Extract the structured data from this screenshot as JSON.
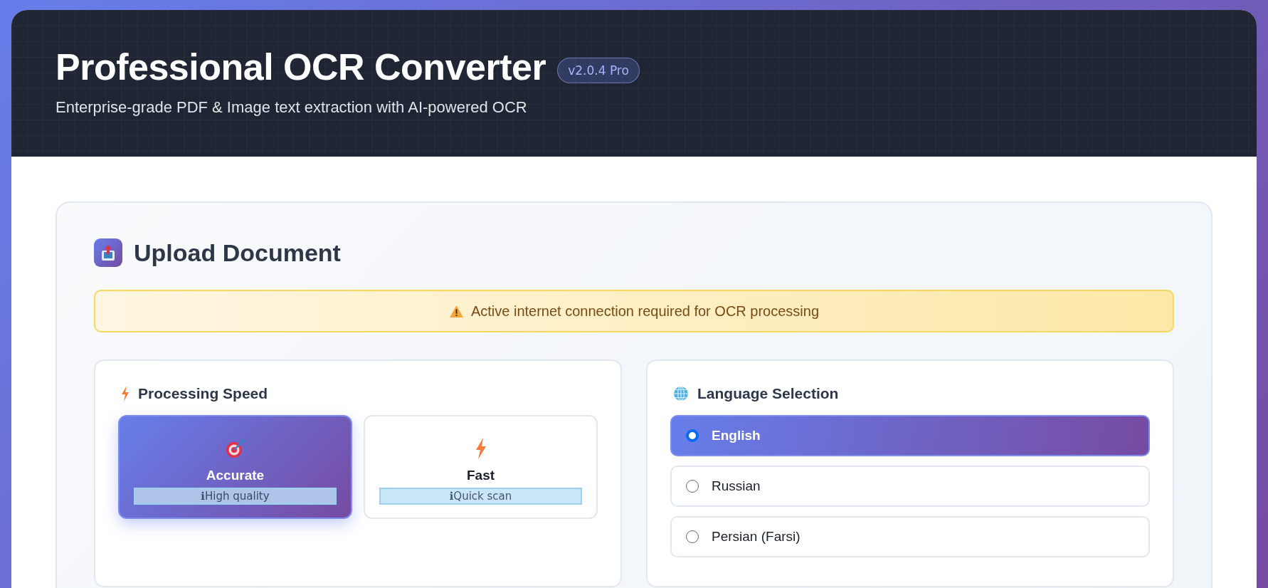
{
  "header": {
    "title": "Professional OCR Converter",
    "version": "v2.0.4 Pro",
    "subtitle": "Enterprise-grade PDF & Image text extraction with AI-powered OCR"
  },
  "upload": {
    "title": "Upload Document",
    "alert": "Active internet connection required for OCR processing"
  },
  "speed": {
    "title": "Processing Speed",
    "options": [
      {
        "kind": "target",
        "label": "Accurate",
        "hint": "ℹHigh quality",
        "selected": true
      },
      {
        "kind": "bolt",
        "label": "Fast",
        "hint": "ℹQuick scan",
        "selected": false
      }
    ]
  },
  "language": {
    "title": "Language Selection",
    "options": [
      {
        "label": "English",
        "selected": true
      },
      {
        "label": "Russian",
        "selected": false
      },
      {
        "label": "Persian (Farsi)",
        "selected": false
      }
    ]
  }
}
